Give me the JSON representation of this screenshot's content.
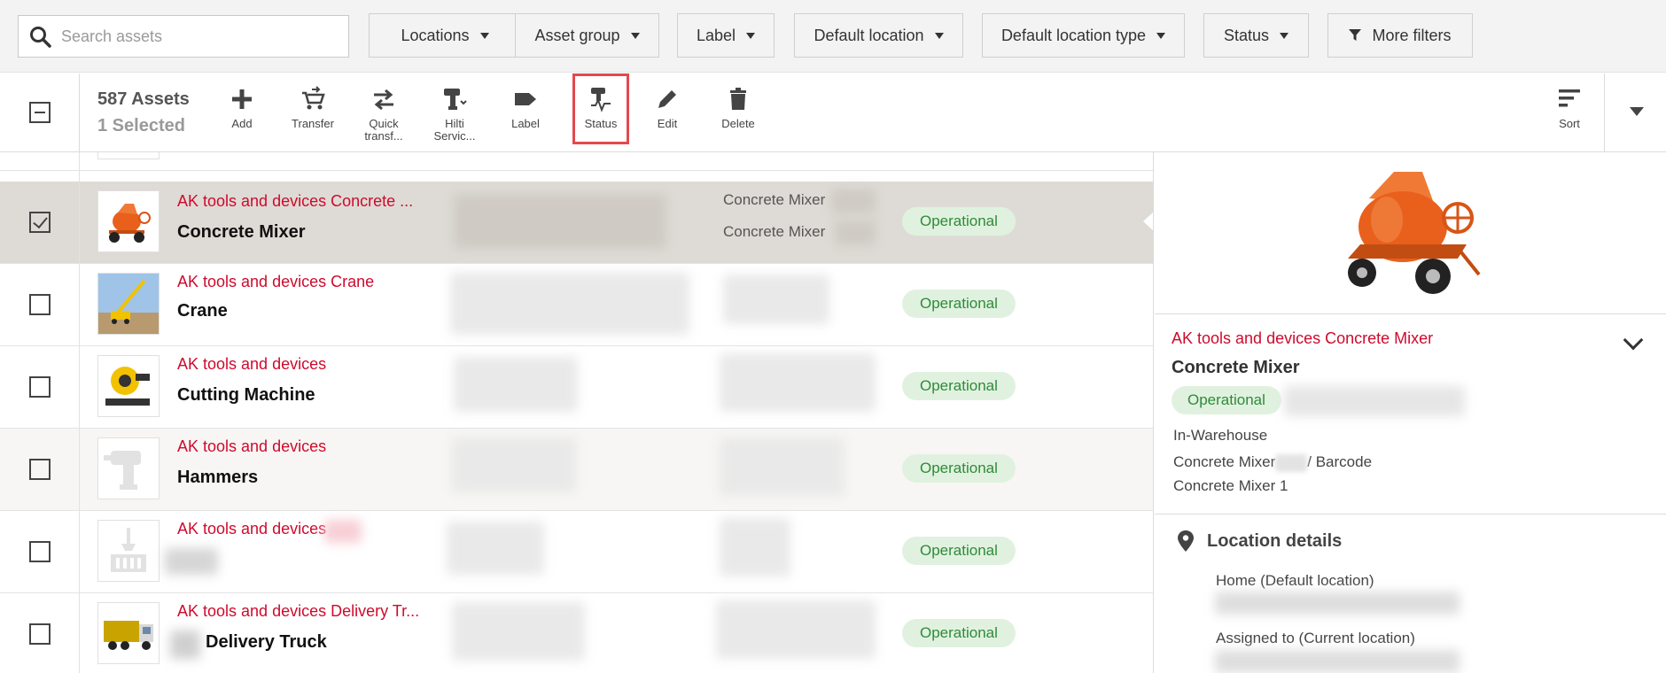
{
  "filters": {
    "search_placeholder": "Search assets",
    "buttons": [
      "Locations",
      "Asset group",
      "Label",
      "Default location",
      "Default location type",
      "Status"
    ],
    "more_filters": "More filters"
  },
  "toolbar": {
    "count": "587 Assets",
    "selected": "1 Selected",
    "tools": [
      {
        "label": "Add",
        "icon": "plus-icon"
      },
      {
        "label": "Transfer",
        "icon": "cart-transfer-icon"
      },
      {
        "label": "Quick transf...",
        "icon": "swap-arrows-icon"
      },
      {
        "label": "Hilti Servic...",
        "icon": "drill-service-icon"
      },
      {
        "label": "Label",
        "icon": "tag-icon"
      },
      {
        "label": "Status",
        "icon": "tool-status-icon"
      },
      {
        "label": "Edit",
        "icon": "pencil-icon"
      },
      {
        "label": "Delete",
        "icon": "trash-icon"
      }
    ],
    "sort": "Sort"
  },
  "rows": [
    {
      "manufacturer": "AK tools and devices Concrete ...",
      "name": "Concrete Mixer",
      "sub1": "Concrete Mixer",
      "sub2": "Concrete Mixer",
      "status": "Operational",
      "checked": true
    },
    {
      "manufacturer": "AK tools and devices Crane",
      "name": "Crane",
      "status": "Operational",
      "checked": false
    },
    {
      "manufacturer": "AK tools and devices",
      "name": "Cutting Machine",
      "status": "Operational",
      "checked": false
    },
    {
      "manufacturer": "AK tools and devices",
      "name": "Hammers",
      "status": "Operational",
      "checked": false
    },
    {
      "manufacturer": "AK tools and devices",
      "name": "",
      "status": "Operational",
      "checked": false
    },
    {
      "manufacturer": "AK tools and devices Delivery Tr...",
      "name": "Delivery Truck",
      "status": "Operational",
      "checked": false
    }
  ],
  "detail": {
    "manufacturer": "AK tools and devices Concrete Mixer",
    "name": "Concrete Mixer",
    "status": "Operational",
    "line1": "In-Warehouse",
    "line2a": "Concrete Mixer",
    "line2b": "/ Barcode",
    "line3": "Concrete Mixer 1",
    "location_title": "Location details",
    "home_label": "Home (Default location)",
    "assigned_label": "Assigned to (Current location)"
  },
  "colors": {
    "accent": "#cf0a2c",
    "status_bg": "#e0f2df",
    "status_fg": "#2f8a3a",
    "highlight": "#e5484d"
  }
}
